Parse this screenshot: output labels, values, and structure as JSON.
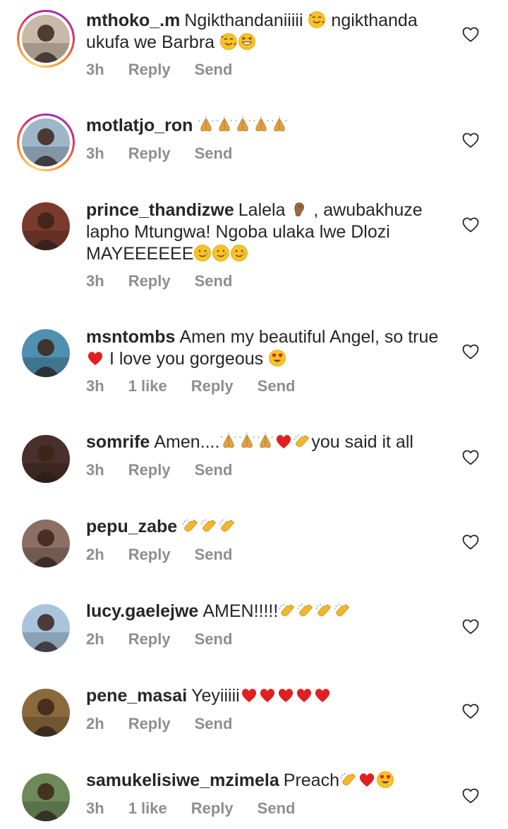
{
  "comments": [
    {
      "username": "mthoko_.m",
      "text_parts": [
        "Ngikthandaniiiii ",
        "{e:smile-hearts}",
        " ngikthanda ukufa we Barbra ",
        "{e:smile-hearts}",
        "{e:grin}"
      ],
      "time": "3h",
      "likes": "",
      "reply": "Reply",
      "send": "Send",
      "story_ring": true,
      "avatar_color": "#c9b9a8"
    },
    {
      "username": "motlatjo_ron",
      "text_parts": [
        "{e:pray}",
        "{e:pray}",
        "{e:pray}",
        "{e:pray}",
        "{e:pray}"
      ],
      "time": "3h",
      "likes": "",
      "reply": "Reply",
      "send": "Send",
      "story_ring": true,
      "avatar_color": "#9fb6c9"
    },
    {
      "username": "prince_thandizwe",
      "text_parts": [
        "Lalela ",
        "{e:ear}",
        " , awubakhuze lapho Mtungwa! Ngoba ulaka lwe Dlozi MAYEEEEEE",
        "{e:tear-smile}",
        "{e:tear-smile}",
        "{e:tear-smile}"
      ],
      "time": "3h",
      "likes": "",
      "reply": "Reply",
      "send": "Send",
      "story_ring": false,
      "avatar_color": "#7a3b2e"
    },
    {
      "username": "msntombs",
      "text_parts": [
        "Amen  my beautiful  Angel,  so true ",
        "{e:heart}",
        " I love  you  gorgeous ",
        "{e:heart-eyes}"
      ],
      "time": "3h",
      "likes": "1 like",
      "reply": "Reply",
      "send": "Send",
      "story_ring": false,
      "avatar_color": "#4f8fb0"
    },
    {
      "username": "somrife",
      "text_parts": [
        "Amen....",
        "{e:pray}",
        "{e:pray}",
        "{e:pray}",
        "{e:heart}",
        "{e:clap}",
        "you said it all"
      ],
      "time": "3h",
      "likes": "",
      "reply": "Reply",
      "send": "Send",
      "story_ring": false,
      "avatar_color": "#4a2f2a"
    },
    {
      "username": "pepu_zabe",
      "text_parts": [
        "{e:clap}",
        "{e:clap}",
        "{e:clap}"
      ],
      "time": "2h",
      "likes": "",
      "reply": "Reply",
      "send": "Send",
      "story_ring": false,
      "avatar_color": "#8d6e63"
    },
    {
      "username": "lucy.gaelejwe",
      "text_parts": [
        "AMEN!!!!!",
        "{e:clap}",
        "{e:clap}",
        "{e:clap}",
        "{e:clap}"
      ],
      "time": "2h",
      "likes": "",
      "reply": "Reply",
      "send": "Send",
      "story_ring": false,
      "avatar_color": "#a9c4dc"
    },
    {
      "username": "pene_masai",
      "text_parts": [
        "Yeyiiiii",
        "{e:heart}",
        "{e:heart}",
        "{e:heart}",
        "{e:heart}",
        "{e:heart}"
      ],
      "time": "2h",
      "likes": "",
      "reply": "Reply",
      "send": "Send",
      "story_ring": false,
      "avatar_color": "#8a6a3c"
    },
    {
      "username": "samukelisiwe_mzimela",
      "text_parts": [
        "Preach",
        "{e:clap}",
        "{e:heart}",
        "{e:heart-eyes}"
      ],
      "time": "3h",
      "likes": "1 like",
      "reply": "Reply",
      "send": "Send",
      "story_ring": false,
      "avatar_color": "#6f8a5a"
    }
  ],
  "colors": {
    "text": "#262626",
    "meta": "#8e8e8e",
    "heart_red": "#e02020",
    "emoji_yellow": "#f7c325"
  }
}
